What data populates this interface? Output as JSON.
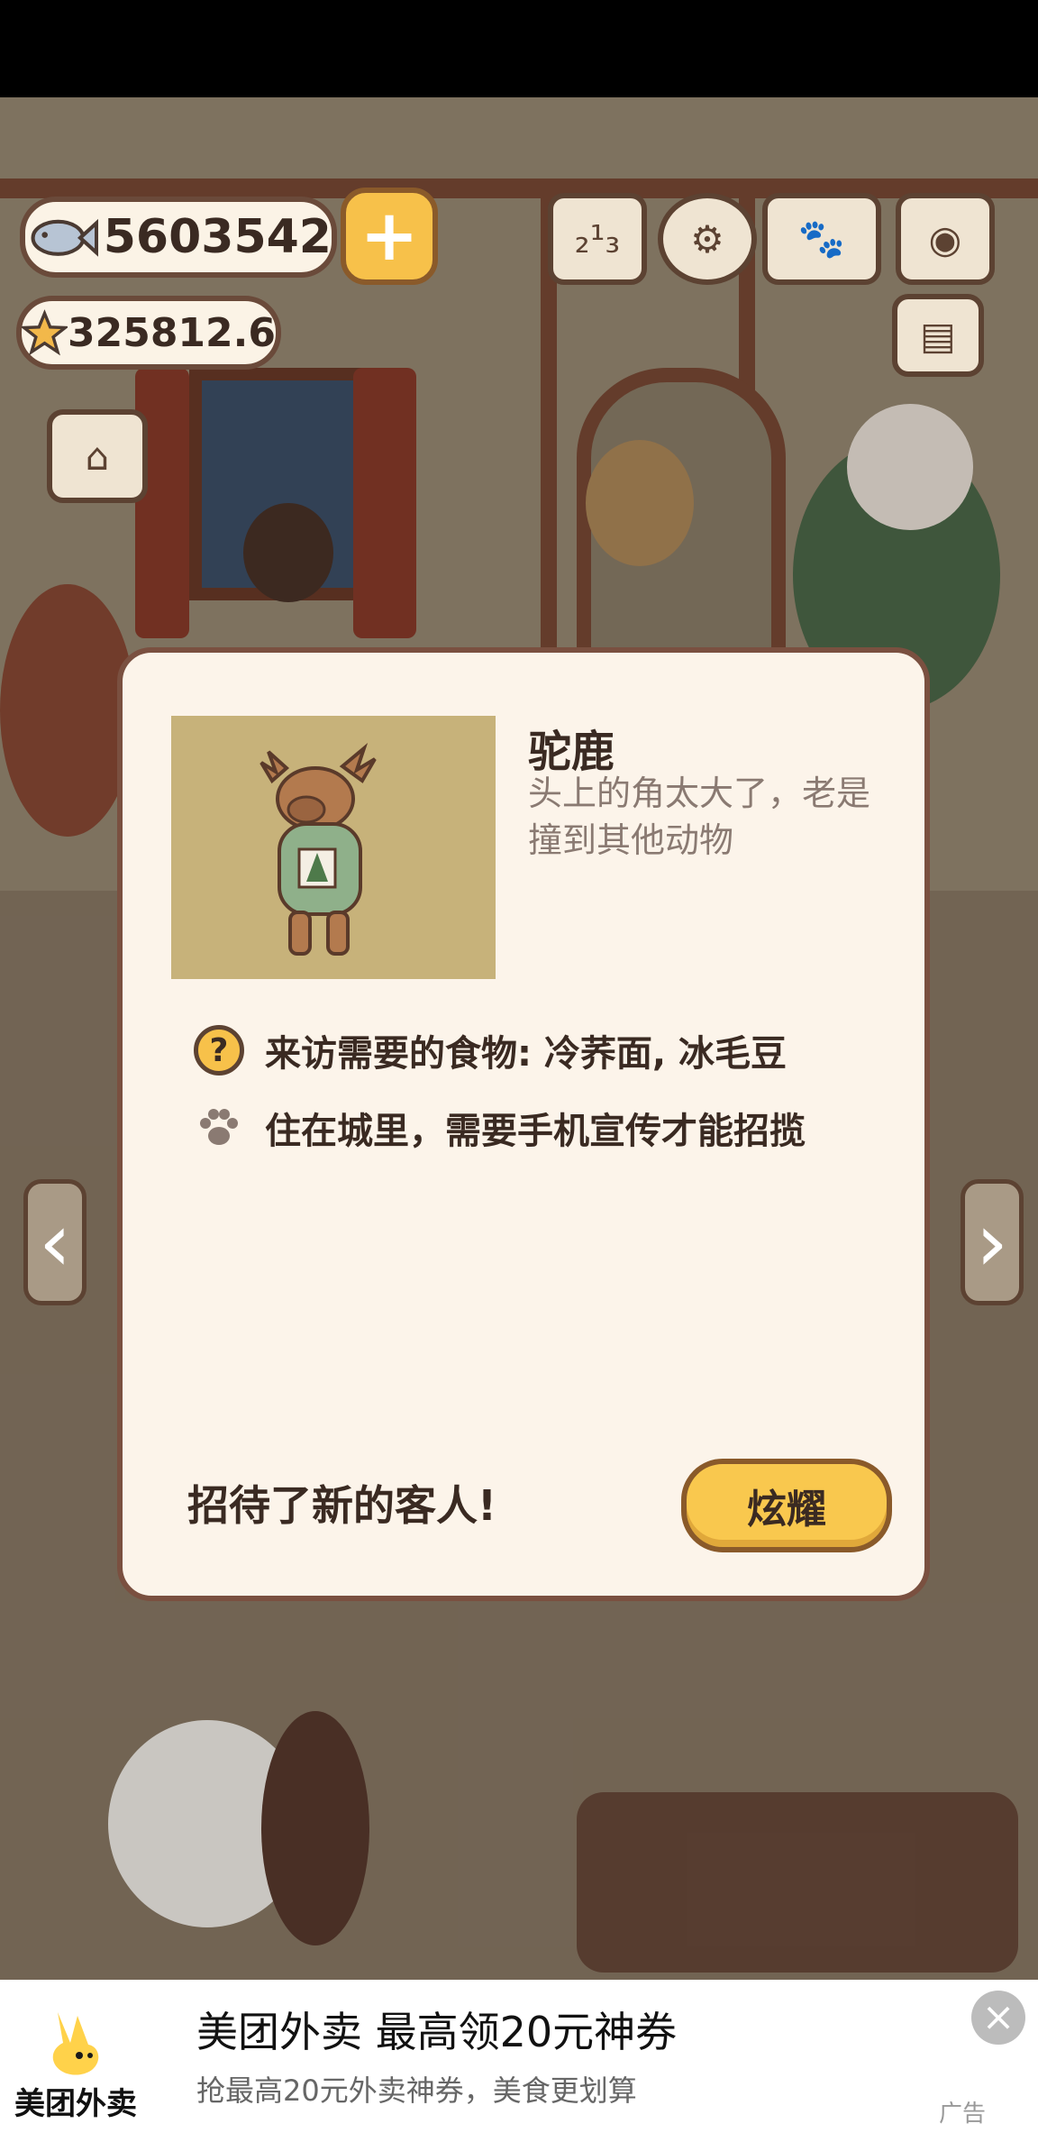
{
  "hud": {
    "fish_count": "5603542",
    "star_count": "325812.6"
  },
  "modal": {
    "animal_name": "驼鹿",
    "animal_description": "头上的角太大了，老是撞到其他动物",
    "food_label": "来访需要的食物: 冷荞面, 冰毛豆",
    "habitat_label": "住在城里，需要手机宣传才能招揽",
    "footer_text": "招待了新的客人!",
    "show_button_label": "炫耀"
  },
  "ad": {
    "brand": "美团外卖",
    "title": "美团外卖 最高领20元神券",
    "subtitle": "抢最高20元外卖神券，美食更划算",
    "tag": "广告"
  },
  "colors": {
    "accent_yellow": "#f9c84e",
    "modal_bg": "#fcf4ea",
    "modal_border": "#7a5040",
    "portrait_bg": "#c7b27a"
  }
}
